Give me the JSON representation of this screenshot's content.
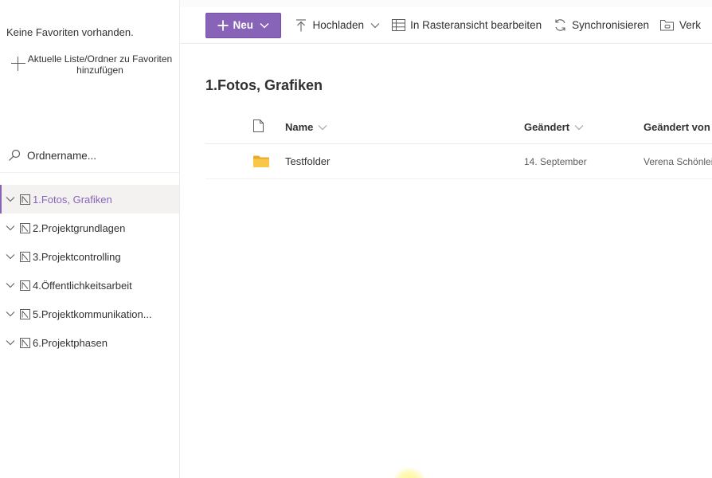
{
  "sidebar": {
    "no_favorites": "Keine Favoriten vorhanden.",
    "add_favorite": "Aktuelle Liste/Ordner zu Favoriten hinzufügen",
    "search_placeholder": "Ordnername...",
    "items": [
      {
        "label": "1.Fotos, Grafiken",
        "selected": true
      },
      {
        "label": "2.Projektgrundlagen"
      },
      {
        "label": "3.Projektcontrolling"
      },
      {
        "label": "4.Öffentlichkeitsarbeit"
      },
      {
        "label": "5.Projektkommunikation..."
      },
      {
        "label": "6.Projektphasen"
      }
    ]
  },
  "toolbar": {
    "new_label": "Neu",
    "upload_label": "Hochladen",
    "grid_edit_label": "In Rasteransicht bearbeiten",
    "sync_label": "Synchronisieren",
    "more_label": "Verk"
  },
  "main": {
    "title": "1.Fotos, Grafiken",
    "columns": {
      "name": "Name",
      "modified": "Geändert",
      "modified_by": "Geändert von"
    },
    "rows": [
      {
        "name": "Testfolder",
        "modified": "14. September",
        "modified_by": "Verena Schönlei"
      }
    ]
  },
  "colors": {
    "accent": "#8764b8",
    "folder": "#f8c748"
  }
}
